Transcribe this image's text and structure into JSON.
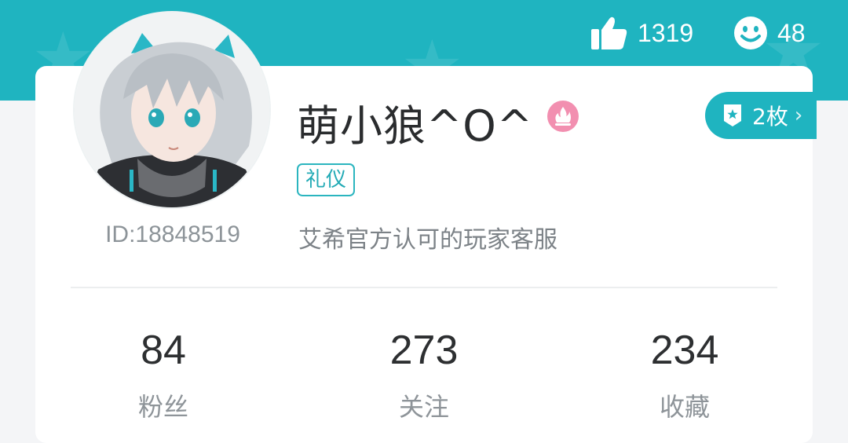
{
  "header": {
    "likes_count": "1319",
    "smiles_count": "48"
  },
  "profile": {
    "username": "萌小狼^O^",
    "tag": "礼仪",
    "bio": "艾希官方认可的玩家客服",
    "user_id": "ID:18848519",
    "badge_count": "2枚",
    "level_icon": "fire-level-icon"
  },
  "stats": [
    {
      "value": "84",
      "label": "粉丝"
    },
    {
      "value": "273",
      "label": "关注"
    },
    {
      "value": "234",
      "label": "收藏"
    }
  ],
  "colors": {
    "accent": "#1fb4c0",
    "level_badge": "#f28fb0"
  }
}
